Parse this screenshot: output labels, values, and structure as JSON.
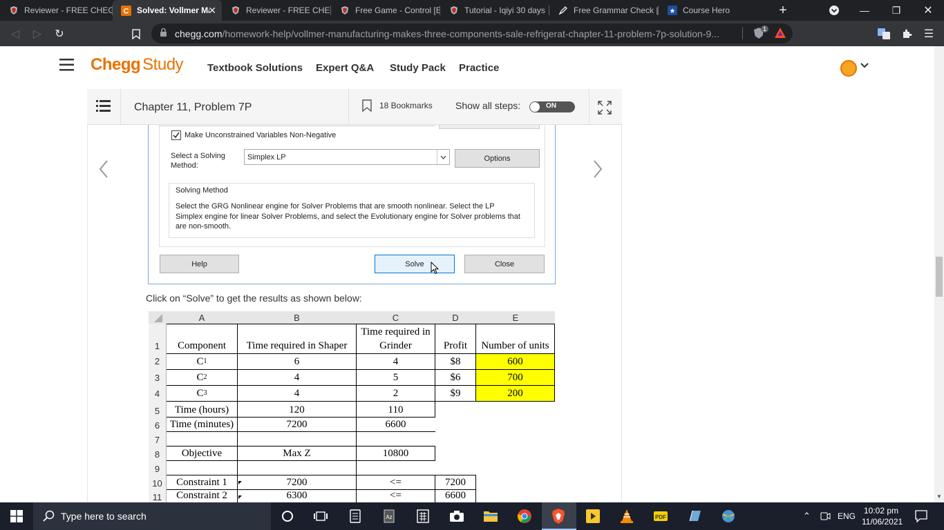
{
  "browser": {
    "tabs": [
      {
        "title": "Reviewer - FREE CHEGG",
        "active": false
      },
      {
        "title": "Solved: Vollmer Ma",
        "active": true
      },
      {
        "title": "Reviewer - FREE CHEGG",
        "active": false
      },
      {
        "title": "Free Game - Control [E",
        "active": false
      },
      {
        "title": "Tutorial - Iqiyi 30 days",
        "active": false
      },
      {
        "title": "Free Grammar Check |",
        "active": false
      },
      {
        "title": "Course Hero",
        "active": false
      }
    ],
    "new_tab": "+",
    "url_domain": "chegg.com",
    "url_path": "/homework-help/vollmer-manufacturing-makes-three-components-sale-refrigerat-chapter-11-problem-7p-solution-9...",
    "shield_badge": "1"
  },
  "chegg": {
    "logo_main": "Chegg",
    "logo_sub": "Study",
    "nav": [
      "Textbook Solutions",
      "Expert Q&A",
      "Study Pack",
      "Practice"
    ],
    "accent": "#eb7100"
  },
  "problem_bar": {
    "title": "Chapter 11, Problem 7P",
    "bookmarks": "18 Bookmarks",
    "show_steps_label": "Show all steps:",
    "toggle": "ON"
  },
  "solver_dialog": {
    "checkbox_label": "Make Unconstrained Variables Non-Negative",
    "checkbox_checked": true,
    "select_label": "Select a Solving Method:",
    "select_value": "Simplex LP",
    "options_button": "Options",
    "group_title": "Solving Method",
    "group_text": "Select the GRG Nonlinear engine for Solver Problems that are smooth nonlinear. Select the LP Simplex engine for linear Solver Problems, and select the Evolutionary engine for Solver problems that are non-smooth.",
    "help_button": "Help",
    "solve_button": "Solve",
    "close_button": "Close"
  },
  "instruction": "Click on “Solve” to get the results as shown below:",
  "spreadsheet": {
    "col_headers": [
      "A",
      "B",
      "C",
      "D",
      "E"
    ],
    "row_headers": [
      "1",
      "2",
      "3",
      "4",
      "5",
      "6",
      "7",
      "8",
      "9",
      "10",
      "11"
    ],
    "row1": [
      "Component",
      "Time required in Shaper",
      "Time required in Grinder",
      "Profit",
      "Number of units"
    ],
    "rows": [
      {
        "a": "C",
        "sub": "1",
        "b": "6",
        "c": "4",
        "d": "$8",
        "e": "600"
      },
      {
        "a": "C",
        "sub": "2",
        "b": "4",
        "c": "5",
        "d": "$6",
        "e": "700"
      },
      {
        "a": "C",
        "sub": "3",
        "b": "4",
        "c": "2",
        "d": "$9",
        "e": "200"
      }
    ],
    "row5": [
      "Time (hours)",
      "120",
      "110"
    ],
    "row6": [
      "Time (minutes)",
      "7200",
      "6600"
    ],
    "row8": [
      "Objective",
      "Max Z",
      "10800"
    ],
    "row10": [
      "Constraint 1",
      "7200",
      "<=",
      "7200"
    ],
    "row11": [
      "Constraint 2",
      "6300",
      "<=",
      "6600"
    ],
    "highlight": "#ffff00"
  },
  "taskbar": {
    "search_placeholder": "Type here to search",
    "lang": "ENG",
    "time": "10:02 pm",
    "date": "11/06/2021"
  }
}
